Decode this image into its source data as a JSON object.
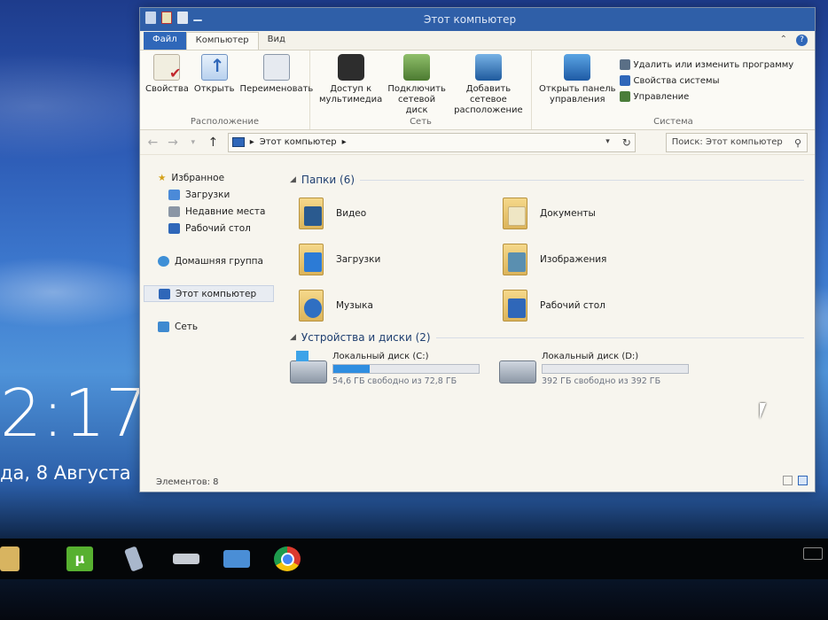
{
  "desktop": {
    "time": "2:17",
    "date": "да, 8 Августа"
  },
  "window": {
    "title": "Этот компьютер",
    "tabs": [
      {
        "label": "Файл"
      },
      {
        "label": "Компьютер"
      },
      {
        "label": "Вид"
      }
    ],
    "ribbon": {
      "location_group": {
        "label": "Расположение",
        "buttons": [
          {
            "label": "Свойства",
            "icon": "properties-icon"
          },
          {
            "label": "Открыть",
            "icon": "open-icon"
          },
          {
            "label": "Переименовать",
            "icon": "rename-icon"
          }
        ]
      },
      "network_group": {
        "label": "Сеть",
        "buttons": [
          {
            "label": "Доступ к мультимедиа",
            "line1": "Доступ к",
            "line2": "мультимедиа",
            "icon": "media-access-icon"
          },
          {
            "label": "Подключить сетевой диск",
            "line1": "Подключить",
            "line2": "сетевой диск",
            "icon": "map-network-drive-icon"
          },
          {
            "label": "Добавить сетевое расположение",
            "line1": "Добавить сетевое",
            "line2": "расположение",
            "icon": "network-location-icon"
          }
        ]
      },
      "system_group": {
        "label": "Система",
        "buttons": [
          {
            "label": "Открыть панель управления",
            "line1": "Открыть панель",
            "line2": "управления",
            "icon": "control-panel-icon"
          }
        ],
        "small": [
          {
            "label": "Удалить или изменить программу"
          },
          {
            "label": "Свойства системы"
          },
          {
            "label": "Управление"
          }
        ]
      }
    },
    "address": {
      "path": "Этот компьютер",
      "search_placeholder": "Поиск: Этот компьютер"
    },
    "nav": {
      "favorites": "Избранное",
      "downloads": "Загрузки",
      "recent": "Недавние места",
      "desktop": "Рабочий стол",
      "homegroup": "Домашняя группа",
      "this_pc": "Этот компьютер",
      "network": "Сеть"
    },
    "folders_section": "Папки (6)",
    "folders": [
      {
        "name": "Видео",
        "color": "#2a5a8f"
      },
      {
        "name": "Документы",
        "color": "#d7c28c"
      },
      {
        "name": "Загрузки",
        "color": "#2c7bd6"
      },
      {
        "name": "Изображения",
        "color": "#5a8fb0"
      },
      {
        "name": "Музыка",
        "color": "#2f6fc2"
      },
      {
        "name": "Рабочий стол",
        "color": "#2f67b9"
      }
    ],
    "devices_section": "Устройства и диски (2)",
    "drives": [
      {
        "name": "Локальный диск (C:)",
        "free_text": "54,6 ГБ свободно из 72,8 ГБ",
        "used_fraction": 0.25,
        "system": true
      },
      {
        "name": "Локальный диск (D:)",
        "free_text": "392 ГБ свободно из 392 ГБ",
        "used_fraction": 0.0,
        "system": false
      }
    ],
    "status": "Элементов: 8"
  },
  "taskbar": {
    "items": [
      "file-explorer",
      "utorrent",
      "tool",
      "drive",
      "this-pc",
      "chrome"
    ]
  }
}
